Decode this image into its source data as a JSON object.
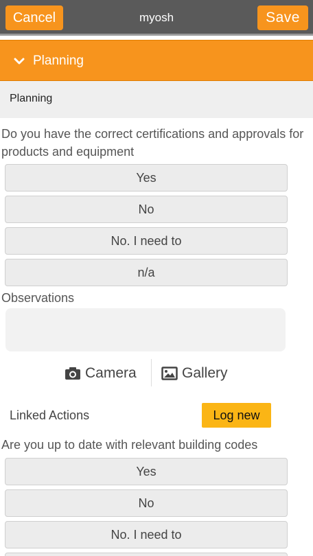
{
  "topbar": {
    "cancel": "Cancel",
    "title": "myosh",
    "save": "Save"
  },
  "section": {
    "title": "Planning"
  },
  "subsection": {
    "title": "Planning"
  },
  "question1": {
    "text": "Do you have the correct certifications and approvals for products and equipment",
    "options": [
      "Yes",
      "No",
      "No. I need to",
      "n/a"
    ]
  },
  "observations": {
    "label": "Observations",
    "value": ""
  },
  "media": {
    "camera": "Camera",
    "gallery": "Gallery"
  },
  "linked_actions": {
    "label": "Linked Actions",
    "button": "Log new"
  },
  "question2": {
    "text": "Are you up to date with relevant building codes",
    "options": [
      "Yes",
      "No",
      "No. I need to"
    ]
  }
}
